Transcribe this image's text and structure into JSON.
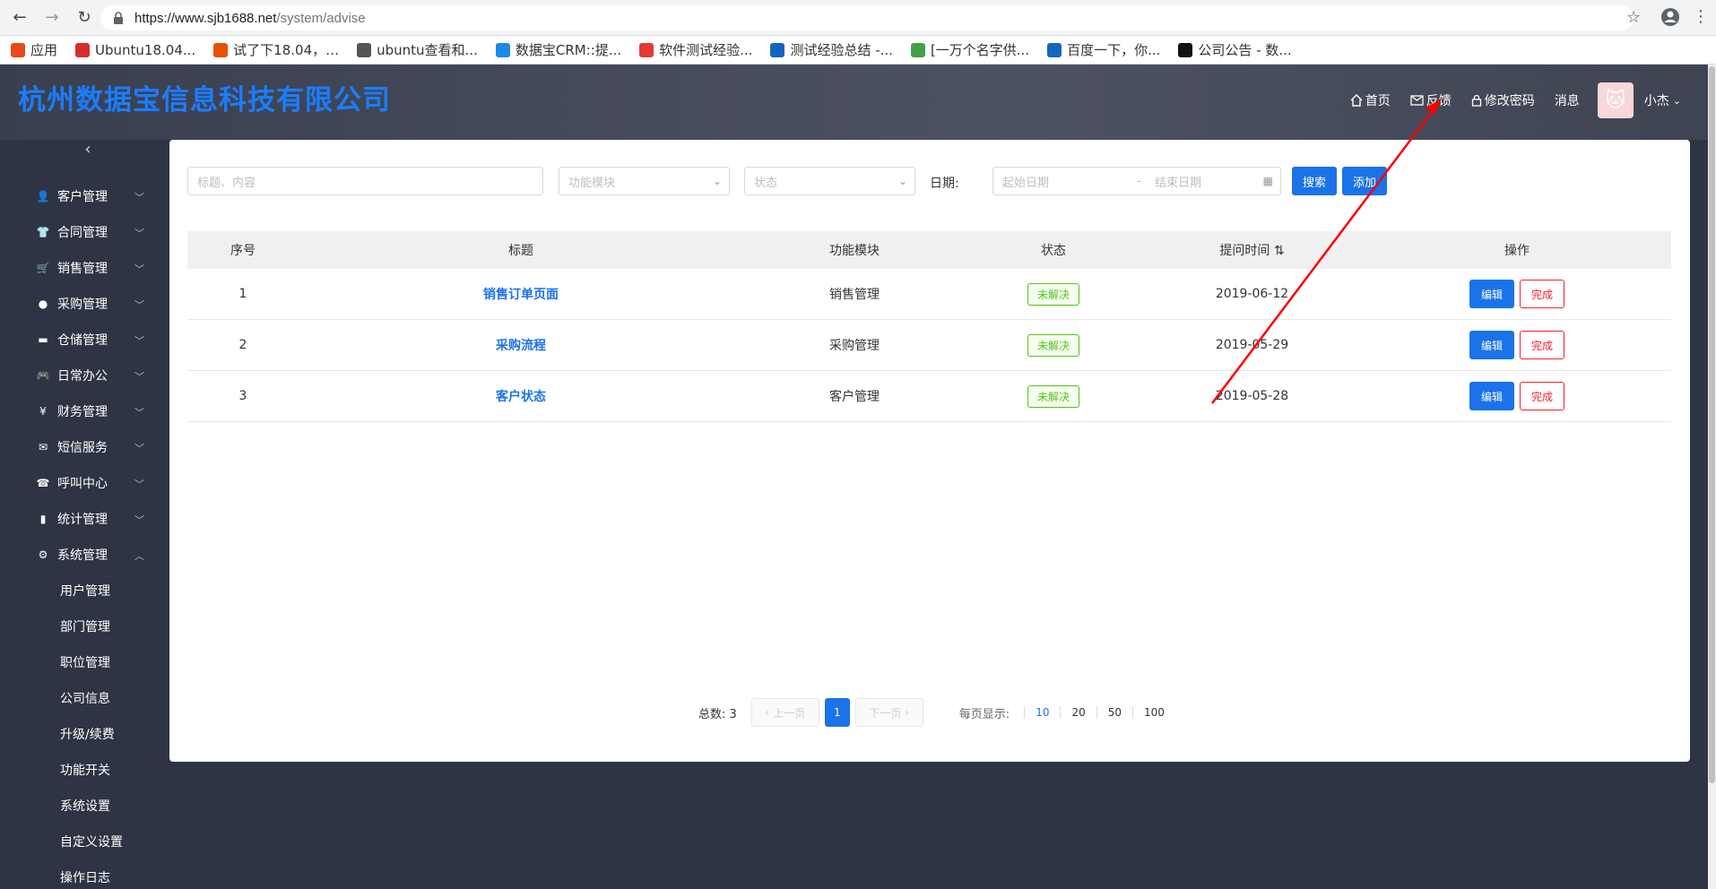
{
  "browser": {
    "url_host": "https://www.sjb1688.net",
    "url_path": "/system/advise",
    "bookmarks": [
      {
        "label": "应用",
        "color": "#e64a19"
      },
      {
        "label": "Ubuntu18.04...",
        "color": "#d32f2f"
      },
      {
        "label": "试了下18.04，…",
        "color": "#e65100"
      },
      {
        "label": "ubuntu查看和...",
        "color": "#555555"
      },
      {
        "label": "数据宝CRM::提...",
        "color": "#1e88e5"
      },
      {
        "label": "软件测试经验...",
        "color": "#e53935"
      },
      {
        "label": "测试经验总结 -...",
        "color": "#1565c0"
      },
      {
        "label": "[一万个名字供...",
        "color": "#43a047"
      },
      {
        "label": "百度一下，你...",
        "color": "#1565c0"
      },
      {
        "label": "公司公告 - 数...",
        "color": "#111111"
      }
    ]
  },
  "header": {
    "company": "杭州数据宝信息科技有限公司",
    "nav": {
      "home": "首页",
      "feedback": "反馈",
      "password": "修改密码",
      "messages": "消息",
      "user": "小杰"
    }
  },
  "sidebar": {
    "items": [
      {
        "label": "客户管理",
        "icon": "user-icon"
      },
      {
        "label": "合同管理",
        "icon": "shirt-icon"
      },
      {
        "label": "销售管理",
        "icon": "cart-icon"
      },
      {
        "label": "采购管理",
        "icon": "circle-icon"
      },
      {
        "label": "仓储管理",
        "icon": "store-icon"
      },
      {
        "label": "日常办公",
        "icon": "gamepad-icon"
      },
      {
        "label": "财务管理",
        "icon": "yen-icon"
      },
      {
        "label": "短信服务",
        "icon": "mail-icon"
      },
      {
        "label": "呼叫中心",
        "icon": "phone-icon"
      },
      {
        "label": "统计管理",
        "icon": "chart-icon"
      },
      {
        "label": "系统管理",
        "icon": "gear-icon"
      }
    ],
    "subitems": [
      "用户管理",
      "部门管理",
      "职位管理",
      "公司信息",
      "升级/续费",
      "功能开关",
      "系统设置",
      "自定义设置",
      "操作日志"
    ]
  },
  "filters": {
    "keyword_placeholder": "标题、内容",
    "module_placeholder": "功能模块",
    "status_placeholder": "状态",
    "date_label": "日期:",
    "start_placeholder": "起始日期",
    "date_sep": "-",
    "end_placeholder": "结束日期",
    "search_btn": "搜索",
    "add_btn": "添加"
  },
  "table": {
    "headers": [
      "序号",
      "标题",
      "功能模块",
      "状态",
      "提问时间 ⇅",
      "操作"
    ],
    "rows": [
      {
        "no": "1",
        "title": "销售订单页面",
        "module": "销售管理",
        "status": "未解决",
        "time": "2019-06-12"
      },
      {
        "no": "2",
        "title": "采购流程",
        "module": "采购管理",
        "status": "未解决",
        "time": "2019-05-29"
      },
      {
        "no": "3",
        "title": "客户状态",
        "module": "客户管理",
        "status": "未解决",
        "time": "2019-05-28"
      }
    ],
    "edit_label": "编辑",
    "done_label": "完成"
  },
  "pager": {
    "total": "总数: 3",
    "prev": "上一页",
    "current": "1",
    "next": "下一页",
    "per_page_label": "每页显示:",
    "sizes": [
      "10",
      "20",
      "50",
      "100"
    ]
  },
  "colors": {
    "accent": "#1a73e8",
    "header_bg": "#3a3f4e",
    "success": "#52c41a",
    "danger": "#f5222d",
    "annotation": "#ff0000"
  }
}
